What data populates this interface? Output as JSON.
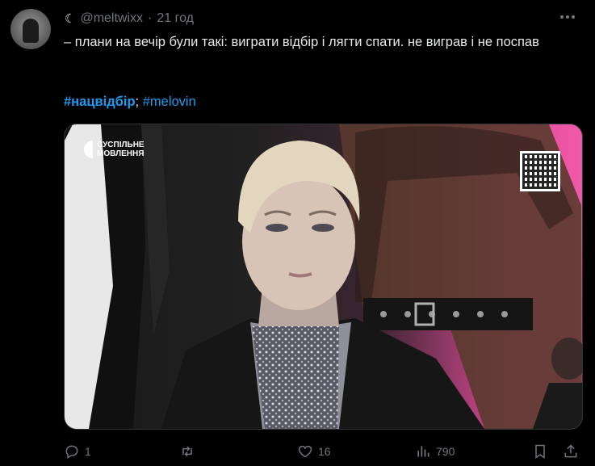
{
  "author": {
    "handle": "@meltwixx",
    "time": "21 год",
    "moon_icon": "crescent-moon-icon"
  },
  "tweet": {
    "text": "– плани на вечір були такі: виграти відбір і лягти спати. не виграв і не поспав",
    "hashtags": [
      "#нацвідбір",
      "#melovin"
    ],
    "separator": ";"
  },
  "media": {
    "channel_logo": "СУСПІЛЬНЕ МОВЛЕННЯ"
  },
  "actions": {
    "replies": "1",
    "retweets": "",
    "likes": "16",
    "views": "790"
  },
  "colors": {
    "accent": "#1d9bf0",
    "muted": "#71767b",
    "text": "#e7e9ea",
    "background": "#000000"
  }
}
